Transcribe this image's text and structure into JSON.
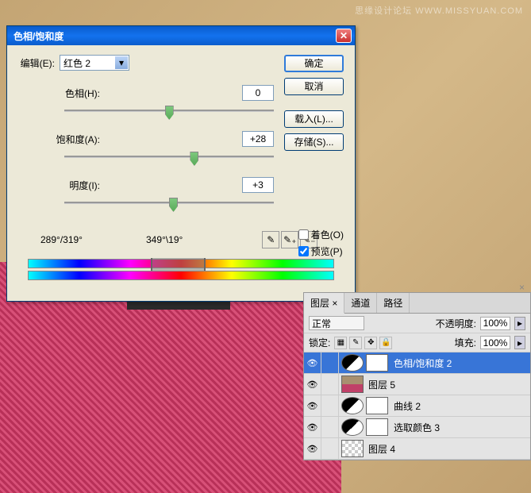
{
  "watermark": "思缘设计论坛  WWW.MISSYUAN.COM",
  "dialog": {
    "title": "色相/饱和度",
    "edit_label": "编辑(E):",
    "edit_value": "红色 2",
    "hue": {
      "label": "色相(H):",
      "value": "0",
      "pos": 48
    },
    "sat": {
      "label": "饱和度(A):",
      "value": "+28",
      "pos": 60
    },
    "light": {
      "label": "明度(I):",
      "value": "+3",
      "pos": 50
    },
    "readout1": "289°/319°",
    "readout2": "349°\\19°",
    "btn_ok": "确定",
    "btn_cancel": "取消",
    "btn_load": "载入(L)...",
    "btn_save": "存储(S)...",
    "chk_colorize": "着色(O)",
    "chk_preview": "预览(P)"
  },
  "layers": {
    "tab1": "图层 ×",
    "tab2": "通道",
    "tab3": "路径",
    "blend_label": "正常",
    "opacity_label": "不透明度:",
    "opacity_value": "100%",
    "lock_label": "锁定:",
    "fill_label": "填充:",
    "fill_value": "100%",
    "items": [
      {
        "name": "色相/饱和度 2",
        "type": "adj",
        "selected": true
      },
      {
        "name": "图层 5",
        "type": "img"
      },
      {
        "name": "曲线 2",
        "type": "adj"
      },
      {
        "name": "选取颜色 3",
        "type": "adj"
      },
      {
        "name": "图层 4",
        "type": "checker"
      }
    ]
  }
}
